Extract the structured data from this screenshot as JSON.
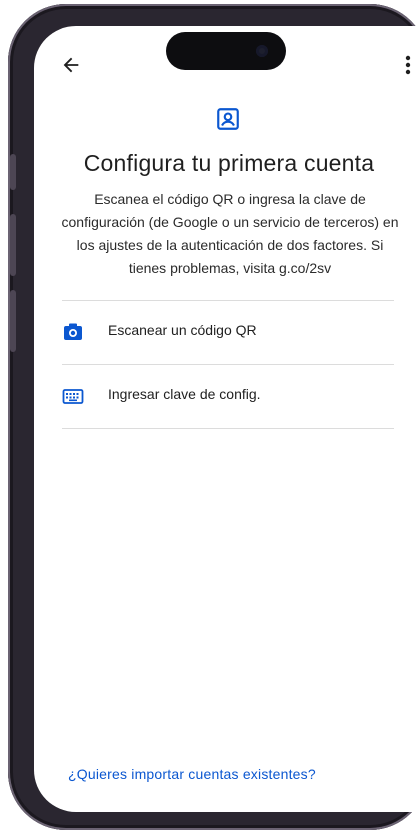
{
  "header": {
    "back_icon": "arrow-back-icon",
    "more_icon": "more-vert-icon"
  },
  "page": {
    "icon": "account-box-icon",
    "title": "Configura tu primera cuenta",
    "description": "Escanea el código QR o ingresa la clave de configuración (de Google o un servicio de terceros) en los ajustes de la autenticación de dos factores. Si tienes problemas, visita g.co/2sv"
  },
  "menu": {
    "items": [
      {
        "label": "Escanear un código QR",
        "icon": "camera-icon"
      },
      {
        "label": "Ingresar clave de config.",
        "icon": "keyboard-icon"
      }
    ]
  },
  "footer": {
    "import_link": "¿Quieres importar cuentas existentes?"
  },
  "colors": {
    "accent": "#0b57d0",
    "text": "#1f1f1f",
    "divider": "#dcdcdc"
  }
}
